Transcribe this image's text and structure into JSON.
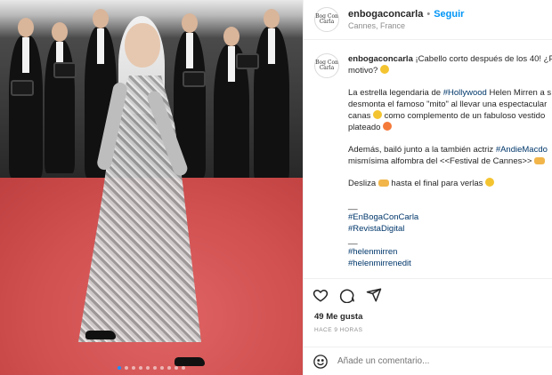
{
  "post": {
    "carousel": {
      "count": 10,
      "active_index": 0
    }
  },
  "header": {
    "avatar_text": "Bog Con Carla",
    "username": "enbogaconcarla",
    "separator": "•",
    "follow_label": "Seguir",
    "location": "Cannes, France"
  },
  "caption": {
    "avatar_text": "Bog Con Carla",
    "username": "enbogaconcarla",
    "p1_a": "¡Cabello corto después de los 40! ¿Po",
    "p1_b": "motivo? ",
    "p2_l1_a": "La estrella legendaria de ",
    "p2_l1_tag": "#Hollywood",
    "p2_l1_b": " Helen Mirren a s",
    "p2_l2": "desmonta el famoso \"mito\" al llevar una espectacular",
    "p2_l3_a": "canas ",
    "p2_l3_b": " como complemento de un fabuloso vestido",
    "p2_l4": "plateado ",
    "p3_l1_a": "Además, bailó junto a la también actriz ",
    "p3_l1_tag": "#AndieMacdo",
    "p3_l2": "mismísima alfombra del <<Festival de Cannes>> ",
    "p4_a": "Desliza ",
    "p4_b": " hasta el final para verlas ",
    "rule1": "__",
    "tag1": "#EnBogaConCarla",
    "tag2": "#RevistaDigital",
    "rule2": "__",
    "tag3": "#helenmirren",
    "tag4": "#helenmirrenedit"
  },
  "actions": {
    "like_icon": "heart-icon",
    "comment_icon": "comment-icon",
    "share_icon": "share-icon"
  },
  "likes_text": "49 Me gusta",
  "time_text": "HACE 9 HORAS",
  "comment": {
    "emoji_icon": "smiley-icon",
    "placeholder": "Añade un comentario..."
  },
  "colors": {
    "accent": "#0095f6",
    "tag": "#00376b",
    "muted": "#8e8e8e"
  }
}
